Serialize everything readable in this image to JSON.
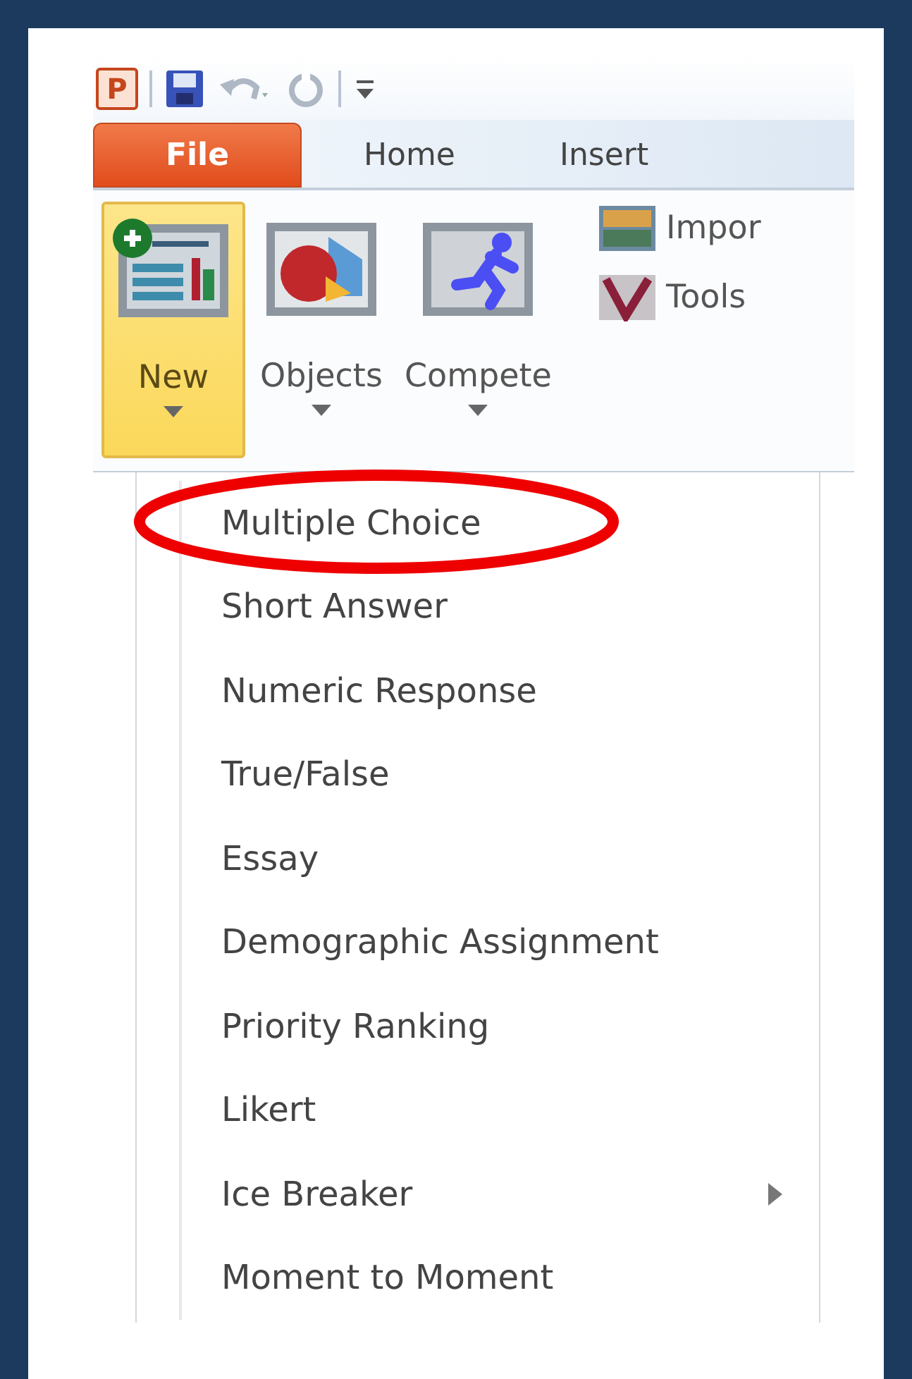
{
  "quick_access": {
    "app_letter": "P"
  },
  "tabs": [
    {
      "label": "File",
      "kind": "file"
    },
    {
      "label": "Home",
      "kind": "tab"
    },
    {
      "label": "Insert",
      "kind": "tab"
    }
  ],
  "ribbon": {
    "large_buttons": [
      {
        "label": "New",
        "highlighted": true,
        "has_dropdown": true
      },
      {
        "label": "Objects",
        "highlighted": false,
        "has_dropdown": true
      },
      {
        "label": "Compete",
        "highlighted": false,
        "has_dropdown": true
      }
    ],
    "small_buttons": [
      {
        "label": "Impor"
      },
      {
        "label": "Tools"
      }
    ]
  },
  "menu": [
    {
      "label": "Multiple Choice",
      "circled": true,
      "submenu": false
    },
    {
      "label": "Short Answer",
      "circled": false,
      "submenu": false
    },
    {
      "label": "Numeric Response",
      "circled": false,
      "submenu": false
    },
    {
      "label": "True/False",
      "circled": false,
      "submenu": false
    },
    {
      "label": "Essay",
      "circled": false,
      "submenu": false
    },
    {
      "label": "Demographic Assignment",
      "circled": false,
      "submenu": false
    },
    {
      "label": "Priority Ranking",
      "circled": false,
      "submenu": false
    },
    {
      "label": "Likert",
      "circled": false,
      "submenu": false
    },
    {
      "label": "Ice Breaker",
      "circled": false,
      "submenu": true
    },
    {
      "label": "Moment to Moment",
      "circled": false,
      "submenu": false
    }
  ]
}
